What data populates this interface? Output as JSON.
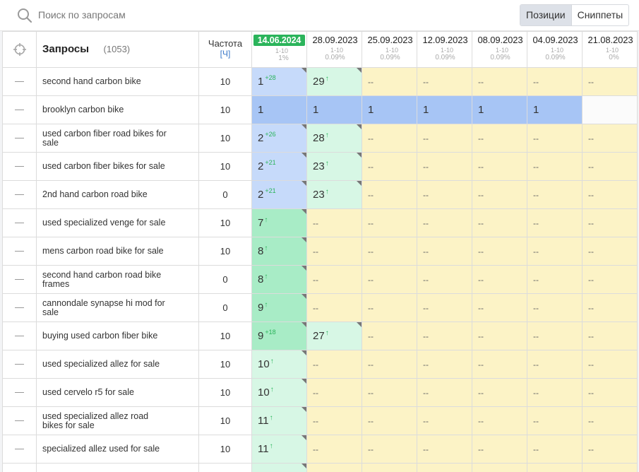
{
  "search": {
    "placeholder": "Поиск по запросам",
    "icon": "search-icon"
  },
  "view_toggle": {
    "positions_label": "Позиции",
    "snippets_label": "Сниппеты",
    "active": "positions"
  },
  "table": {
    "header": {
      "target_icon": "target-icon",
      "queries_label": "Запросы",
      "queries_count": "(1053)",
      "frequency_label": "Частота",
      "frequency_unit": "[Ч]"
    },
    "dates": [
      {
        "date": "14.06.2024",
        "range": "1-10",
        "pct": "1%",
        "active": true
      },
      {
        "date": "28.09.2023",
        "range": "1-10",
        "pct": "0.09%",
        "active": false
      },
      {
        "date": "25.09.2023",
        "range": "1-10",
        "pct": "0.09%",
        "active": false
      },
      {
        "date": "12.09.2023",
        "range": "1-10",
        "pct": "0.09%",
        "active": false
      },
      {
        "date": "08.09.2023",
        "range": "1-10",
        "pct": "0.09%",
        "active": false
      },
      {
        "date": "04.09.2023",
        "range": "1-10",
        "pct": "0.09%",
        "active": false
      },
      {
        "date": "21.08.2023",
        "range": "1-10",
        "pct": "0%",
        "active": false
      }
    ],
    "rows": [
      {
        "query": "second hand carbon bike",
        "freq": "10",
        "cells": [
          {
            "v": "1",
            "delta": "+28",
            "bg": "blue",
            "corner": true
          },
          {
            "v": "29",
            "arrow": "↑",
            "bg": "green-light",
            "corner": true
          },
          {
            "v": "--",
            "bg": "yellow"
          },
          {
            "v": "--",
            "bg": "yellow"
          },
          {
            "v": "--",
            "bg": "yellow"
          },
          {
            "v": "--",
            "bg": "yellow"
          },
          {
            "v": "--",
            "bg": "yellow"
          }
        ]
      },
      {
        "query": "brooklyn carbon bike",
        "freq": "10",
        "cells": [
          {
            "v": "1",
            "bg": "blue-dark"
          },
          {
            "v": "1",
            "bg": "blue-dark"
          },
          {
            "v": "1",
            "bg": "blue-dark"
          },
          {
            "v": "1",
            "bg": "blue-dark"
          },
          {
            "v": "1",
            "bg": "blue-dark"
          },
          {
            "v": "1",
            "bg": "blue-dark"
          },
          {
            "v": "",
            "bg": "white"
          }
        ]
      },
      {
        "query": "used carbon fiber road bikes for sale",
        "freq": "10",
        "cells": [
          {
            "v": "2",
            "delta": "+26",
            "bg": "blue",
            "corner": true
          },
          {
            "v": "28",
            "arrow": "↑",
            "bg": "green-light",
            "corner": true
          },
          {
            "v": "--",
            "bg": "yellow"
          },
          {
            "v": "--",
            "bg": "yellow"
          },
          {
            "v": "--",
            "bg": "yellow"
          },
          {
            "v": "--",
            "bg": "yellow"
          },
          {
            "v": "--",
            "bg": "yellow"
          }
        ]
      },
      {
        "query": "used carbon fiber bikes for sale",
        "freq": "10",
        "cells": [
          {
            "v": "2",
            "delta": "+21",
            "bg": "blue",
            "corner": true
          },
          {
            "v": "23",
            "arrow": "↑",
            "bg": "green-light",
            "corner": true
          },
          {
            "v": "--",
            "bg": "yellow"
          },
          {
            "v": "--",
            "bg": "yellow"
          },
          {
            "v": "--",
            "bg": "yellow"
          },
          {
            "v": "--",
            "bg": "yellow"
          },
          {
            "v": "--",
            "bg": "yellow"
          }
        ]
      },
      {
        "query": "2nd hand carbon road bike",
        "freq": "0",
        "cells": [
          {
            "v": "2",
            "delta": "+21",
            "bg": "blue",
            "corner": true
          },
          {
            "v": "23",
            "arrow": "↑",
            "bg": "green-light",
            "corner": true
          },
          {
            "v": "--",
            "bg": "yellow"
          },
          {
            "v": "--",
            "bg": "yellow"
          },
          {
            "v": "--",
            "bg": "yellow"
          },
          {
            "v": "--",
            "bg": "yellow"
          },
          {
            "v": "--",
            "bg": "yellow"
          }
        ]
      },
      {
        "query": "used specialized venge for sale",
        "freq": "10",
        "cells": [
          {
            "v": "7",
            "arrow": "↑",
            "bg": "green",
            "corner": true
          },
          {
            "v": "--",
            "bg": "yellow"
          },
          {
            "v": "--",
            "bg": "yellow"
          },
          {
            "v": "--",
            "bg": "yellow"
          },
          {
            "v": "--",
            "bg": "yellow"
          },
          {
            "v": "--",
            "bg": "yellow"
          },
          {
            "v": "--",
            "bg": "yellow"
          }
        ]
      },
      {
        "query": "mens carbon road bike for sale",
        "freq": "10",
        "cells": [
          {
            "v": "8",
            "arrow": "↑",
            "bg": "green",
            "corner": true
          },
          {
            "v": "--",
            "bg": "yellow"
          },
          {
            "v": "--",
            "bg": "yellow"
          },
          {
            "v": "--",
            "bg": "yellow"
          },
          {
            "v": "--",
            "bg": "yellow"
          },
          {
            "v": "--",
            "bg": "yellow"
          },
          {
            "v": "--",
            "bg": "yellow"
          }
        ]
      },
      {
        "query": "second hand carbon road bike frames",
        "freq": "0",
        "cells": [
          {
            "v": "8",
            "arrow": "↑",
            "bg": "green",
            "corner": true
          },
          {
            "v": "--",
            "bg": "yellow"
          },
          {
            "v": "--",
            "bg": "yellow"
          },
          {
            "v": "--",
            "bg": "yellow"
          },
          {
            "v": "--",
            "bg": "yellow"
          },
          {
            "v": "--",
            "bg": "yellow"
          },
          {
            "v": "--",
            "bg": "yellow"
          }
        ]
      },
      {
        "query": "cannondale synapse hi mod for sale",
        "freq": "0",
        "cells": [
          {
            "v": "9",
            "arrow": "↑",
            "bg": "green",
            "corner": true
          },
          {
            "v": "--",
            "bg": "yellow"
          },
          {
            "v": "--",
            "bg": "yellow"
          },
          {
            "v": "--",
            "bg": "yellow"
          },
          {
            "v": "--",
            "bg": "yellow"
          },
          {
            "v": "--",
            "bg": "yellow"
          },
          {
            "v": "--",
            "bg": "yellow"
          }
        ]
      },
      {
        "query": "buying used carbon fiber bike",
        "freq": "10",
        "cells": [
          {
            "v": "9",
            "delta": "+18",
            "bg": "green",
            "corner": true
          },
          {
            "v": "27",
            "arrow": "↑",
            "bg": "green-light",
            "corner": true
          },
          {
            "v": "--",
            "bg": "yellow"
          },
          {
            "v": "--",
            "bg": "yellow"
          },
          {
            "v": "--",
            "bg": "yellow"
          },
          {
            "v": "--",
            "bg": "yellow"
          },
          {
            "v": "--",
            "bg": "yellow"
          }
        ]
      },
      {
        "query": "used specialized allez for sale",
        "freq": "10",
        "cells": [
          {
            "v": "10",
            "arrow": "↑",
            "bg": "green-light",
            "corner": true
          },
          {
            "v": "--",
            "bg": "yellow"
          },
          {
            "v": "--",
            "bg": "yellow"
          },
          {
            "v": "--",
            "bg": "yellow"
          },
          {
            "v": "--",
            "bg": "yellow"
          },
          {
            "v": "--",
            "bg": "yellow"
          },
          {
            "v": "--",
            "bg": "yellow"
          }
        ]
      },
      {
        "query": "used cervelo r5 for sale",
        "freq": "10",
        "cells": [
          {
            "v": "10",
            "arrow": "↑",
            "bg": "green-light",
            "corner": true
          },
          {
            "v": "--",
            "bg": "yellow"
          },
          {
            "v": "--",
            "bg": "yellow"
          },
          {
            "v": "--",
            "bg": "yellow"
          },
          {
            "v": "--",
            "bg": "yellow"
          },
          {
            "v": "--",
            "bg": "yellow"
          },
          {
            "v": "--",
            "bg": "yellow"
          }
        ]
      },
      {
        "query": "used specialized allez road bikes for sale",
        "freq": "10",
        "cells": [
          {
            "v": "11",
            "arrow": "↑",
            "bg": "green-light",
            "corner": true
          },
          {
            "v": "--",
            "bg": "yellow"
          },
          {
            "v": "--",
            "bg": "yellow"
          },
          {
            "v": "--",
            "bg": "yellow"
          },
          {
            "v": "--",
            "bg": "yellow"
          },
          {
            "v": "--",
            "bg": "yellow"
          },
          {
            "v": "--",
            "bg": "yellow"
          }
        ]
      },
      {
        "query": "specialized allez used for sale",
        "freq": "10",
        "cells": [
          {
            "v": "11",
            "arrow": "↑",
            "bg": "green-light",
            "corner": true
          },
          {
            "v": "--",
            "bg": "yellow"
          },
          {
            "v": "--",
            "bg": "yellow"
          },
          {
            "v": "--",
            "bg": "yellow"
          },
          {
            "v": "--",
            "bg": "yellow"
          },
          {
            "v": "--",
            "bg": "yellow"
          },
          {
            "v": "--",
            "bg": "yellow"
          }
        ]
      },
      {
        "query": "",
        "freq": "",
        "cells": [
          {
            "v": "",
            "bg": "green-light",
            "corner": true
          },
          {
            "v": "",
            "bg": "yellow"
          },
          {
            "v": "",
            "bg": "yellow"
          },
          {
            "v": "",
            "bg": "yellow"
          },
          {
            "v": "",
            "bg": "yellow"
          },
          {
            "v": "",
            "bg": "yellow"
          },
          {
            "v": "",
            "bg": "yellow"
          }
        ]
      }
    ]
  }
}
